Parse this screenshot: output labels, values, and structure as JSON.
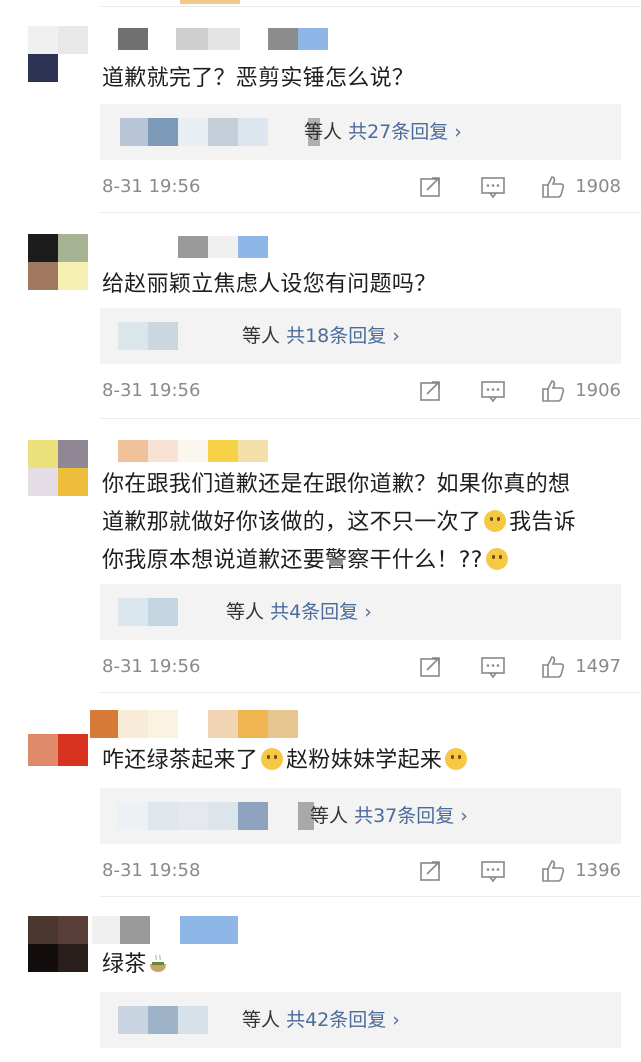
{
  "reply_prefix": "等人",
  "comments": [
    {
      "text": "道歉就完了？恶剪实锤怎么说？",
      "reply_count_text": "共27条回复",
      "reply_arrow": "›",
      "time": "8-31 19:56",
      "likes": "1908"
    },
    {
      "text": "给赵丽颖立焦虑人设您有问题吗？",
      "reply_count_text": "共18条回复",
      "reply_arrow": "›",
      "time": "8-31 19:56",
      "likes": "1906"
    },
    {
      "text_line1": "你在跟我们道歉还是在跟你道歉？如果你真的想",
      "text_line2a": "道歉那就做好你该做的，这不只一次了",
      "text_line2b": "我告诉",
      "text_line3": "你我原本想说道歉还要警察干什么！??",
      "reply_count_text": "共4条回复",
      "reply_arrow": "›",
      "time": "8-31 19:56",
      "likes": "1497"
    },
    {
      "text_a": "咋还绿茶起来了",
      "text_b": "赵粉妹妹学起来",
      "reply_count_text": "共37条回复",
      "reply_arrow": "›",
      "time": "8-31 19:58",
      "likes": "1396"
    },
    {
      "text": "绿茶",
      "reply_count_text": "共42条回复",
      "reply_arrow": "›"
    }
  ],
  "icons": {
    "repost": "repost-icon",
    "comment": "comment-icon",
    "like": "thumbs-up-icon",
    "emoji_smile": "smile-emoji-icon",
    "emoji_cry": "cry-emoji-icon",
    "emoji_sad": "sad-emoji-icon",
    "tea": "tea-cup-icon"
  },
  "colors": {
    "link": "#4b6b98",
    "meta": "#8a8a8a",
    "reply_bg": "#f3f3f3",
    "emoji": "#f7c843"
  }
}
